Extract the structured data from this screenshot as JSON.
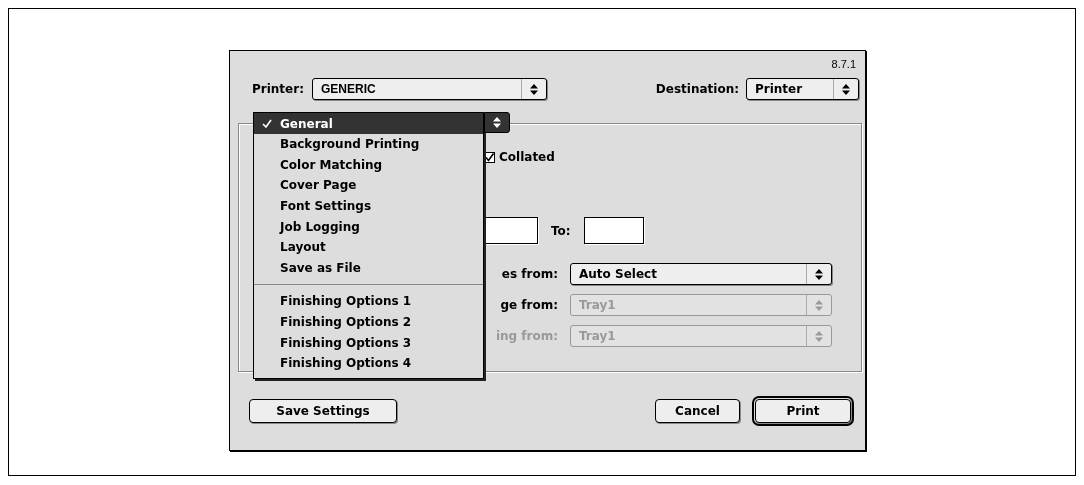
{
  "version": "8.7.1",
  "printer": {
    "label": "Printer:",
    "value": "GENERIC"
  },
  "destination": {
    "label": "Destination:",
    "value": "Printer"
  },
  "panel_menu": {
    "groups": [
      [
        {
          "label": "General",
          "selected": true
        },
        {
          "label": "Background Printing",
          "selected": false
        },
        {
          "label": "Color Matching",
          "selected": false
        },
        {
          "label": "Cover Page",
          "selected": false
        },
        {
          "label": "Font Settings",
          "selected": false
        },
        {
          "label": "Job Logging",
          "selected": false
        },
        {
          "label": "Layout",
          "selected": false
        },
        {
          "label": "Save as File",
          "selected": false
        }
      ],
      [
        {
          "label": "Finishing Options 1",
          "selected": false
        },
        {
          "label": "Finishing Options 2",
          "selected": false
        },
        {
          "label": "Finishing Options 3",
          "selected": false
        },
        {
          "label": "Finishing Options 4",
          "selected": false
        }
      ]
    ]
  },
  "collated": {
    "label": "Collated",
    "checked": true
  },
  "page_range": {
    "to_label": "To:"
  },
  "sources": [
    {
      "label": "es from:",
      "label_disabled": false,
      "value": "Auto Select",
      "disabled": false
    },
    {
      "label": "ge from:",
      "label_disabled": false,
      "value": "Tray1",
      "disabled": true
    },
    {
      "label": "ing from:",
      "label_disabled": true,
      "value": "Tray1",
      "disabled": true
    }
  ],
  "left_buttons": [
    {
      "label": "Save Settings",
      "default": false
    }
  ],
  "right_buttons": [
    {
      "label": "Cancel",
      "default": false
    },
    {
      "label": "Print",
      "default": true
    }
  ]
}
